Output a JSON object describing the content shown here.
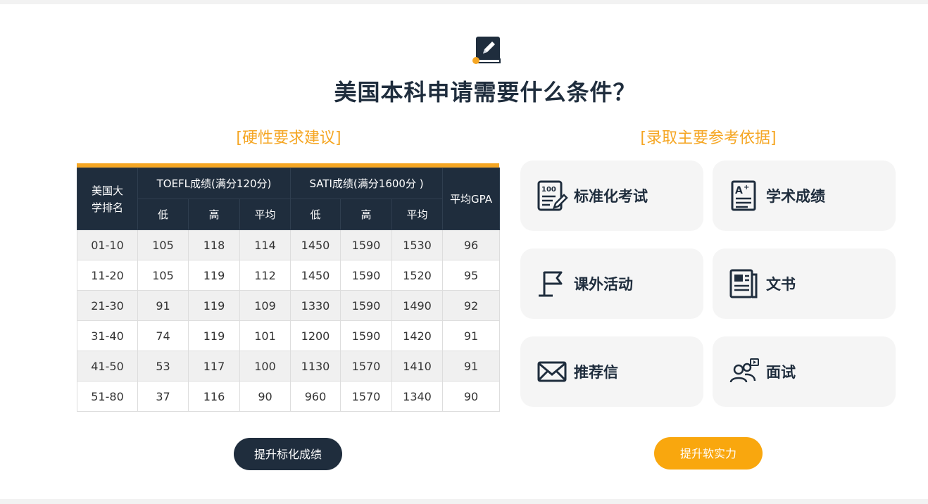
{
  "page": {
    "title": "美国本科申请需要什么条件？",
    "left_section_title": "[硬性要求建议]",
    "right_section_title": "[录取主要参考依据]"
  },
  "table": {
    "col_rank": "美国大学排名",
    "col_toefl": "TOEFL成绩(满分120分)",
    "col_sat": "SATI成绩(满分1600分 )",
    "col_gpa": "平均GPA",
    "sub_low": "低",
    "sub_high": "高",
    "sub_avg": "平均",
    "rows": [
      [
        "01-10",
        "105",
        "118",
        "114",
        "1450",
        "1590",
        "1530",
        "96"
      ],
      [
        "11-20",
        "105",
        "119",
        "112",
        "1450",
        "1590",
        "1520",
        "95"
      ],
      [
        "21-30",
        "91",
        "119",
        "109",
        "1330",
        "1590",
        "1490",
        "92"
      ],
      [
        "31-40",
        "74",
        "119",
        "101",
        "1200",
        "1590",
        "1420",
        "91"
      ],
      [
        "41-50",
        "53",
        "117",
        "100",
        "1130",
        "1570",
        "1410",
        "91"
      ],
      [
        "51-80",
        "37",
        "116",
        "90",
        "960",
        "1570",
        "1340",
        "90"
      ]
    ]
  },
  "cards": [
    {
      "label": "标准化考试",
      "icon": "exam-score-icon"
    },
    {
      "label": "学术成绩",
      "icon": "grade-a-plus-icon"
    },
    {
      "label": "课外活动",
      "icon": "flag-icon"
    },
    {
      "label": "文书",
      "icon": "newspaper-icon"
    },
    {
      "label": "推荐信",
      "icon": "envelope-icon"
    },
    {
      "label": "面试",
      "icon": "interview-people-icon"
    }
  ],
  "buttons": {
    "improve_scores": "提升标化成绩",
    "improve_soft": "提升软实力"
  },
  "colors": {
    "accent": "#f5a623",
    "dark": "#1f2d3d",
    "button_orange": "#f9a70e"
  }
}
